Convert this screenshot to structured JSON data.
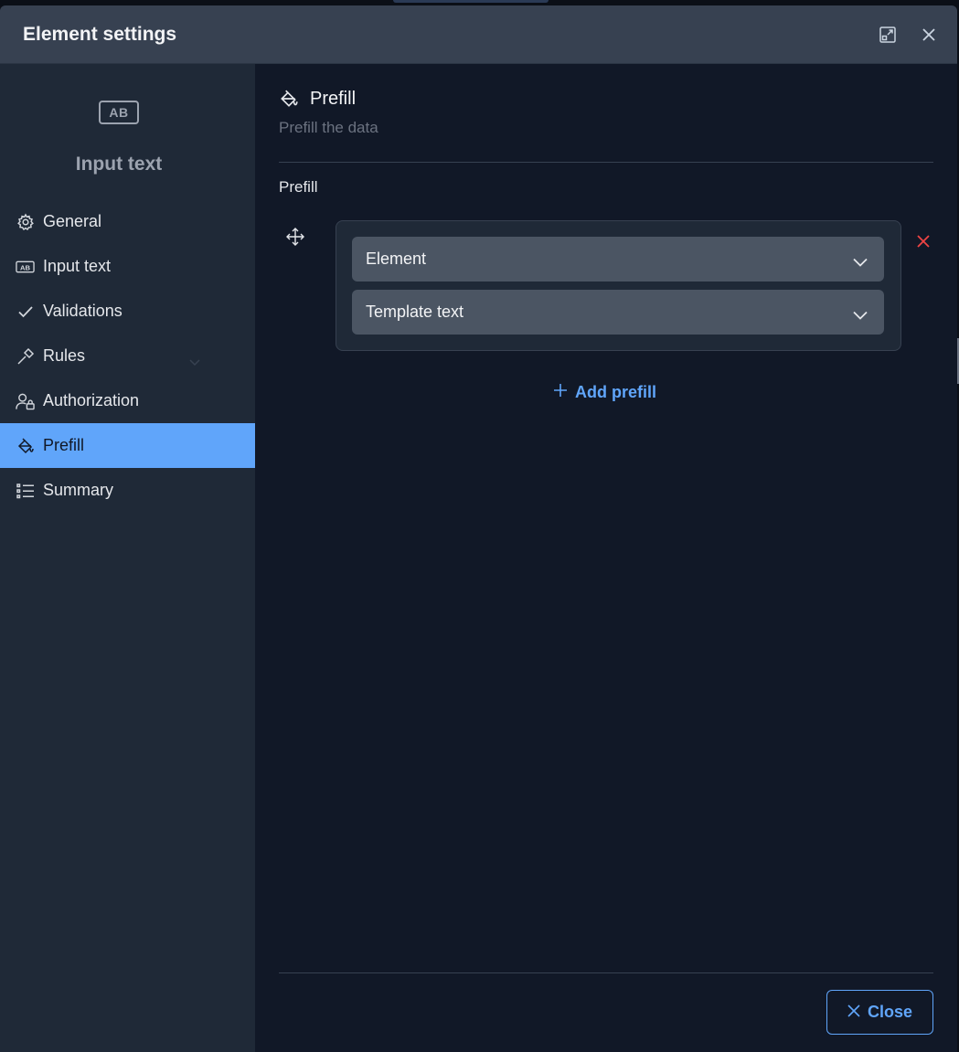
{
  "header": {
    "title": "Element settings"
  },
  "sidebar": {
    "badge": "AB",
    "element_type": "Input text",
    "items": [
      {
        "label": "General",
        "icon": "gear-icon"
      },
      {
        "label": "Input text",
        "icon": "input-text-icon"
      },
      {
        "label": "Validations",
        "icon": "check-icon"
      },
      {
        "label": "Rules",
        "icon": "hammer-icon"
      },
      {
        "label": "Authorization",
        "icon": "user-lock-icon"
      },
      {
        "label": "Prefill",
        "icon": "paint-bucket-icon",
        "active": true
      },
      {
        "label": "Summary",
        "icon": "list-icon"
      }
    ]
  },
  "main": {
    "section_title": "Prefill",
    "section_subtitle": "Prefill the data",
    "field_label": "Prefill",
    "prefill": {
      "source_select": "Element",
      "type_select": "Template text"
    },
    "add_label": "Add prefill",
    "close_label": "Close"
  },
  "colors": {
    "accent": "#60a5fa",
    "danger": "#ef4444",
    "header_bg": "#374151",
    "sidebar_bg": "#1f2937",
    "main_bg": "#111827"
  }
}
